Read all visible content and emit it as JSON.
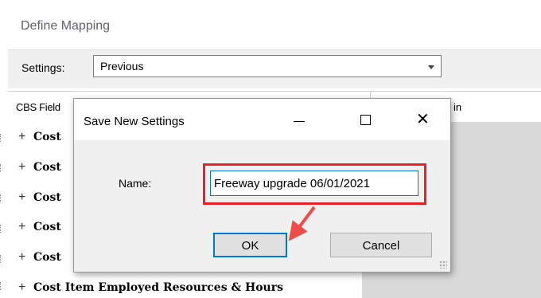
{
  "window": {
    "title": "Define Mapping"
  },
  "settings": {
    "label": "Settings:",
    "value": "Previous"
  },
  "grid": {
    "col1_header": "CBS Field",
    "col2_header": "in",
    "rows": [
      {
        "label": "Cost"
      },
      {
        "label": "Cost"
      },
      {
        "label": "Cost"
      },
      {
        "label": "Cost"
      },
      {
        "label": "Cost"
      },
      {
        "label": "Cost Item Employed Resources & Hours"
      }
    ]
  },
  "dialog": {
    "title": "Save New Settings",
    "name_label": "Name:",
    "name_value": "Freeway upgrade 06/01/2021",
    "ok_label": "OK",
    "cancel_label": "Cancel"
  },
  "icons": {
    "expand": "+",
    "minimize": "minimize-icon",
    "maximize": "maximize-icon",
    "close": "✕"
  },
  "colors": {
    "highlight": "#e8212a",
    "arrow": "#ef4b4b",
    "focus": "#0078d7"
  }
}
